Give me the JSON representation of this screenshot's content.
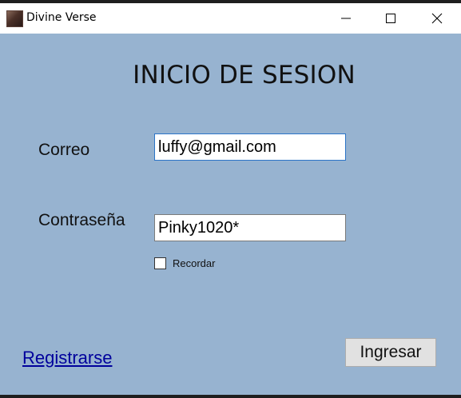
{
  "window": {
    "title": "Divine Verse",
    "icon": "app-thumbnail-icon",
    "controls": [
      "minimize-icon",
      "maximize-icon",
      "close-icon"
    ]
  },
  "form": {
    "heading": "INICIO DE SESION",
    "email_label": "Correo",
    "email_value": "luffy@gmail.com",
    "password_label": "Contraseña",
    "password_value": "Pinky1020*",
    "remember_label": "Recordar",
    "remember_checked": false,
    "register_link": "Registrarse",
    "submit_label": "Ingresar"
  },
  "colors": {
    "background": "#97b3d0",
    "link": "#00009c",
    "focus_border": "#2b74c7"
  }
}
